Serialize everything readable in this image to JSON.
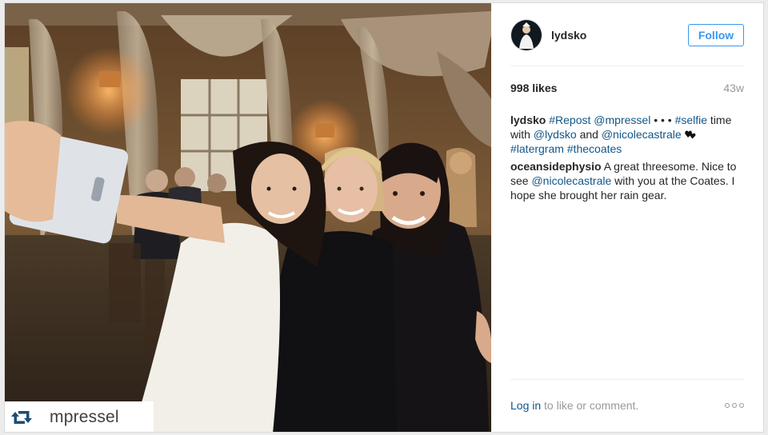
{
  "post": {
    "repost_username": "mpressel",
    "author": {
      "username": "lydsko",
      "follow_label": "Follow"
    },
    "likes": "998 likes",
    "age": "43w",
    "caption": {
      "username": "lydsko",
      "tag_repost": "#Repost",
      "mention_mpressel": "@mpressel",
      "dots": " • • •",
      "tag_selfie": "#selfie",
      "text_time_with": " time with ",
      "mention_lydsko": "@lydsko",
      "text_and": " and",
      "mention_nicole": "@nicolecastrale",
      "tag_latergram": "#latergram",
      "tag_thecoates": "#thecoates"
    },
    "comment": {
      "username": "oceansidephysio",
      "text_1": " A great threesome. Nice to see ",
      "mention_nicole": "@nicolecastrale",
      "text_2": " with you at the Coates. I hope she brought her rain gear."
    },
    "footer": {
      "login_label": "Log in",
      "login_suffix": " to like or comment."
    }
  },
  "icons": {
    "repost": "repost-icon",
    "heart": "black-hearts-icon",
    "more": "more-options-icon"
  },
  "colors": {
    "accent": "#3897f0",
    "link": "#125688",
    "text": "#262626",
    "muted": "#999999"
  }
}
